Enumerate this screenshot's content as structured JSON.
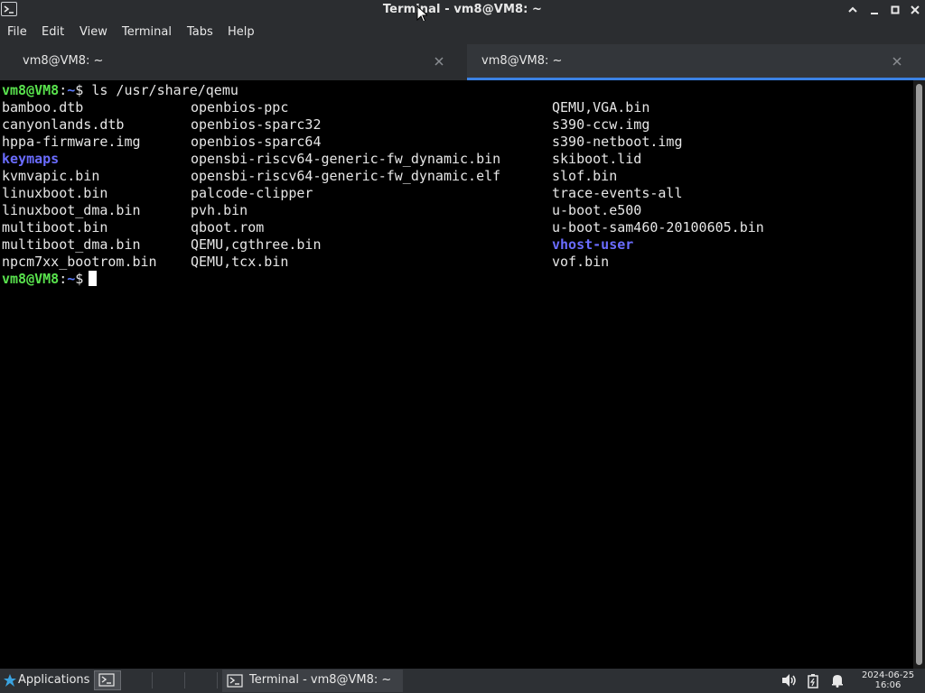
{
  "window": {
    "title": "Terminal - vm8@VM8: ~"
  },
  "menu": [
    "File",
    "Edit",
    "View",
    "Terminal",
    "Tabs",
    "Help"
  ],
  "tabs": [
    {
      "label": "vm8@VM8: ~",
      "active": false
    },
    {
      "label": "vm8@VM8: ~",
      "active": true
    }
  ],
  "terminal": {
    "prompt_user": "vm8@VM8",
    "prompt_sep": ":",
    "prompt_path": "~",
    "prompt_sym": "$",
    "command": " ls /usr/share/qemu",
    "col1": [
      "bamboo.dtb",
      "canyonlands.dtb",
      "hppa-firmware.img",
      "keymaps",
      "kvmvapic.bin",
      "linuxboot.bin",
      "linuxboot_dma.bin",
      "multiboot.bin",
      "multiboot_dma.bin",
      "npcm7xx_bootrom.bin"
    ],
    "col2": [
      "openbios-ppc",
      "openbios-sparc32",
      "openbios-sparc64",
      "opensbi-riscv64-generic-fw_dynamic.bin",
      "opensbi-riscv64-generic-fw_dynamic.elf",
      "palcode-clipper",
      "pvh.bin",
      "qboot.rom",
      "QEMU,cgthree.bin",
      "QEMU,tcx.bin"
    ],
    "col3": [
      "QEMU,VGA.bin",
      "s390-ccw.img",
      "s390-netboot.img",
      "skiboot.lid",
      "slof.bin",
      "trace-events-all",
      "u-boot.e500",
      "u-boot-sam460-20100605.bin",
      "vhost-user",
      "vof.bin"
    ],
    "directories": [
      "keymaps",
      "vhost-user"
    ]
  },
  "taskbar": {
    "applications_label": "Applications",
    "task_label": "Terminal - vm8@VM8: ~",
    "date": "2024-06-25",
    "time": "16:06"
  },
  "icons": {
    "app": "terminal-icon",
    "minimize": "chevron-down-icon",
    "maximize": "square-icon",
    "close": "close-icon",
    "volume": "speaker-icon",
    "battery": "battery-icon",
    "notifications": "bell-icon"
  },
  "colors": {
    "prompt_user": "#59e24d",
    "prompt_path": "#5c7cff",
    "directory": "#6a6cff",
    "tab_accent": "#3b82e4"
  }
}
